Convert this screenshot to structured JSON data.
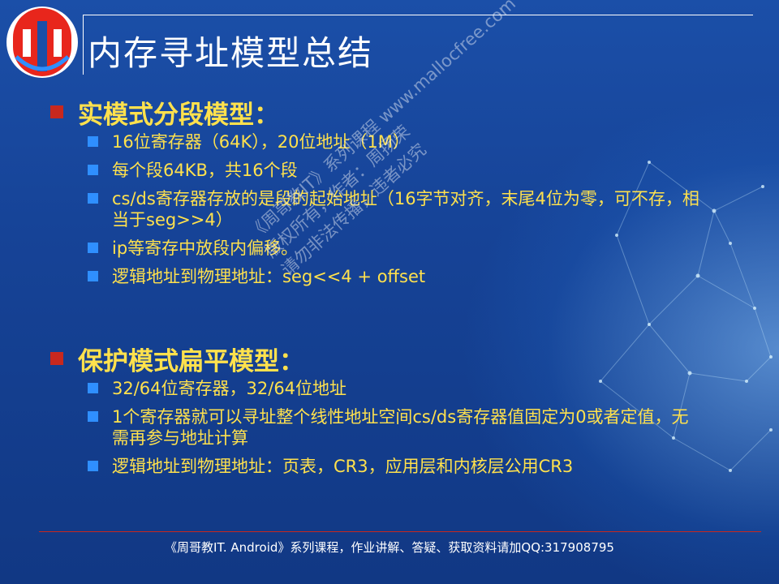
{
  "slide": {
    "title": "内存寻址模型总结",
    "sections": [
      {
        "title": "实模式分段模型：",
        "items": [
          "16位寄存器（64K），20位地址（1M）",
          "每个段64KB，共16个段",
          "cs/ds寄存器存放的是段的起始地址（16字节对齐，末尾4位为零，可不存，相当于seg>>4）",
          "ip等寄存中放段内偏移。",
          "逻辑地址到物理地址：seg<<4 + offset"
        ]
      },
      {
        "title": "保护模式扁平模型：",
        "items": [
          "32/64位寄存器，32/64位地址",
          "1个寄存器就可以寻址整个线性地址空间cs/ds寄存器值固定为0或者定值，无需再参与地址计算",
          "逻辑地址到物理地址：页表，CR3，应用层和内核层公用CR3"
        ]
      }
    ],
    "watermark": [
      "《周哥教IT》系列课程 www.mallocfree.com",
      "版权所有，作者：周扬荣",
      "请勿非法传播，违者必究"
    ],
    "footer": "《周哥教IT. Android》系列课程，作业讲解、答疑、获取资料请加QQ:317908795"
  },
  "colors": {
    "background": "#164397",
    "title_text": "#ffffff",
    "section_text": "#ffe14d",
    "section_bullet": "#c8281e",
    "item_bullet": "#2f8fff",
    "footer_rule": "#c8281e",
    "logo_red": "#e8261c"
  },
  "icons": {
    "logo": "mallocfree-logo",
    "section_bullet": "red-square-bullet",
    "item_bullet": "blue-square-bullet",
    "decoration": "network-globe"
  }
}
